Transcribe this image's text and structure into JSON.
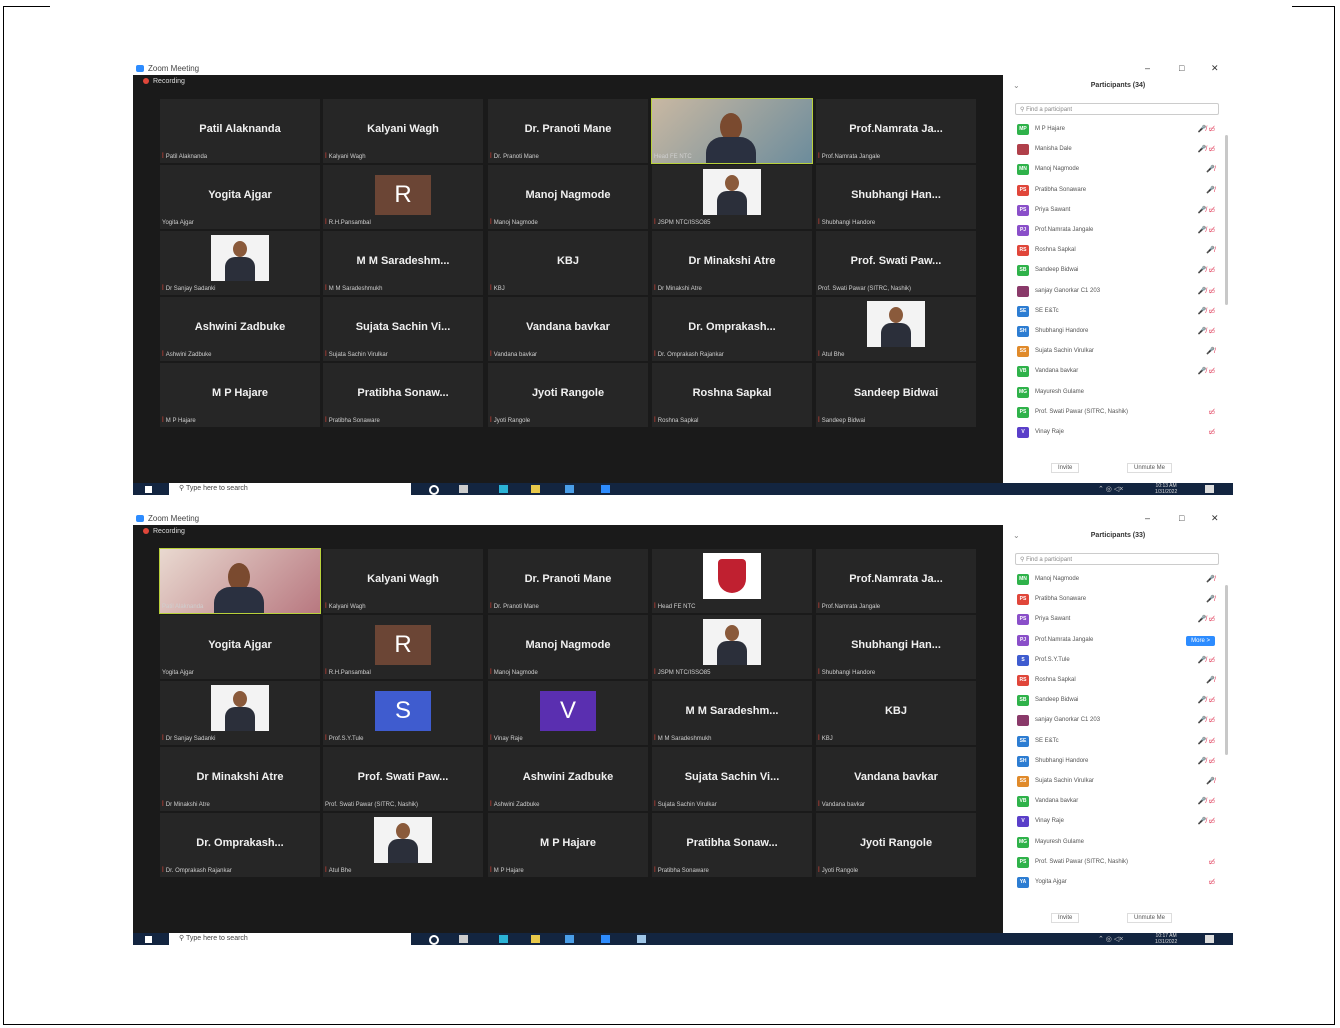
{
  "top": {
    "window_title": "Zoom Meeting",
    "recording": "Recording",
    "tiles": [
      {
        "name": "Patil Alaknanda",
        "label": "Patil Alaknanda",
        "type": "name"
      },
      {
        "name": "Kalyani Wagh",
        "label": "Kalyani Wagh",
        "type": "name"
      },
      {
        "name": "Dr. Pranoti Mane",
        "label": "Dr. Pranoti Mane",
        "type": "name"
      },
      {
        "name": "",
        "label": "Head FE NTC",
        "type": "video"
      },
      {
        "name": "Prof.Namrata Ja...",
        "label": "Prof.Namrata Jangale",
        "type": "name"
      },
      {
        "name": "Yogita Ajgar",
        "label": "Yogita Ajgar",
        "type": "name"
      },
      {
        "name": "R",
        "label": "R.H.Pansambal",
        "type": "avatar",
        "color": "#6b4535"
      },
      {
        "name": "Manoj Nagmode",
        "label": "Manoj Nagmode",
        "type": "name"
      },
      {
        "name": "",
        "label": "JSPM NTC/ISSO85",
        "type": "photo"
      },
      {
        "name": "Shubhangi Han...",
        "label": "Shubhangi Handore",
        "type": "name"
      },
      {
        "name": "",
        "label": "Dr Sanjay Sadanki",
        "type": "photo"
      },
      {
        "name": "M M Saradeshm...",
        "label": "M M Saradeshmukh",
        "type": "name"
      },
      {
        "name": "KBJ",
        "label": "KBJ",
        "type": "name"
      },
      {
        "name": "Dr Minakshi Atre",
        "label": "Dr Minakshi Atre",
        "type": "name"
      },
      {
        "name": "Prof. Swati Paw...",
        "label": "Prof. Swati Pawar (SITRC, Nashik)",
        "type": "name"
      },
      {
        "name": "Ashwini Zadbuke",
        "label": "Ashwini Zadbuke",
        "type": "name"
      },
      {
        "name": "Sujata Sachin Vi...",
        "label": "Sujata Sachin Virulkar",
        "type": "name"
      },
      {
        "name": "Vandana bavkar",
        "label": "Vandana bavkar",
        "type": "name"
      },
      {
        "name": "Dr. Omprakash...",
        "label": "Dr. Omprakash Rajankar",
        "type": "name"
      },
      {
        "name": "",
        "label": "Atul Bhe",
        "type": "photo"
      },
      {
        "name": "M P Hajare",
        "label": "M P Hajare",
        "type": "name"
      },
      {
        "name": "Pratibha Sonaw...",
        "label": "Pratibha Sonaware",
        "type": "name"
      },
      {
        "name": "Jyoti Rangole",
        "label": "Jyoti Rangole",
        "type": "name"
      },
      {
        "name": "Roshna Sapkal",
        "label": "Roshna Sapkal",
        "type": "name"
      },
      {
        "name": "Sandeep Bidwai",
        "label": "Sandeep Bidwai",
        "type": "name"
      }
    ],
    "panel_title": "Participants (34)",
    "search_placeholder": "Find a participant",
    "participants": [
      {
        "initials": "MP",
        "name": "M P Hajare",
        "color": "#2fb24a",
        "icons": "🎤̸ ▭̸"
      },
      {
        "initials": "",
        "name": "Manisha Dale",
        "color": "#b0404a",
        "icons": "🎤̸ ▭̸"
      },
      {
        "initials": "MN",
        "name": "Manoj Nagmode",
        "color": "#2fb24a",
        "icons": "🎤̸"
      },
      {
        "initials": "PS",
        "name": "Pratibha Sonaware",
        "color": "#e0463a",
        "icons": "🎤̸"
      },
      {
        "initials": "PS",
        "name": "Priya Sawant",
        "color": "#8a4fc9",
        "icons": "🎤̸ ▭̸"
      },
      {
        "initials": "PJ",
        "name": "Prof.Namrata Jangale",
        "color": "#8a4fc9",
        "icons": "🎤̸ ▭̸"
      },
      {
        "initials": "RS",
        "name": "Roshna Sapkal",
        "color": "#e0463a",
        "icons": "🎤̸"
      },
      {
        "initials": "SB",
        "name": "Sandeep Bidwai",
        "color": "#2fb24a",
        "icons": "🎤̸ ▭̸"
      },
      {
        "initials": "",
        "name": "sanjay Ganorkar C1 203",
        "color": "#8a3a6a",
        "icons": "🎤̸ ▭̸"
      },
      {
        "initials": "SE",
        "name": "SE E&Tc",
        "color": "#2d7dd2",
        "icons": "🎤̸ ▭̸"
      },
      {
        "initials": "SH",
        "name": "Shubhangi Handore",
        "color": "#2d7dd2",
        "icons": "🎤̸ ▭̸"
      },
      {
        "initials": "SS",
        "name": "Sujata Sachin Virulkar",
        "color": "#e08a2a",
        "icons": "🎤̸"
      },
      {
        "initials": "VB",
        "name": "Vandana bavkar",
        "color": "#2fb24a",
        "icons": "🎤̸ ▭̸"
      },
      {
        "initials": "MG",
        "name": "Mayuresh Gulame",
        "color": "#2fb24a",
        "icons": ""
      },
      {
        "initials": "PS",
        "name": "Prof. Swati Pawar (SITRC, Nashik)",
        "color": "#2fb24a",
        "icons": "▭̸"
      },
      {
        "initials": "V",
        "name": "Vinay Raje",
        "color": "#5a3fc9",
        "icons": "▭̸"
      }
    ],
    "invite": "Invite",
    "unmute": "Unmute Me",
    "taskbar_search": "Type here to search",
    "time": "10:13 AM",
    "date": "1/31/2022"
  },
  "bottom": {
    "window_title": "Zoom Meeting",
    "recording": "Recording",
    "tiles": [
      {
        "name": "",
        "label": "Patil Alaknanda",
        "type": "video2"
      },
      {
        "name": "Kalyani Wagh",
        "label": "Kalyani Wagh",
        "type": "name"
      },
      {
        "name": "Dr. Pranoti Mane",
        "label": "Dr. Pranoti Mane",
        "type": "name"
      },
      {
        "name": "",
        "label": "Head FE NTC",
        "type": "logo"
      },
      {
        "name": "Prof.Namrata Ja...",
        "label": "Prof.Namrata Jangale",
        "type": "name"
      },
      {
        "name": "Yogita Ajgar",
        "label": "Yogita Ajgar",
        "type": "name"
      },
      {
        "name": "R",
        "label": "R.H.Pansambal",
        "type": "avatar",
        "color": "#6b4535"
      },
      {
        "name": "Manoj Nagmode",
        "label": "Manoj Nagmode",
        "type": "name"
      },
      {
        "name": "",
        "label": "JSPM NTC/ISSO85",
        "type": "photo"
      },
      {
        "name": "Shubhangi Han...",
        "label": "Shubhangi Handore",
        "type": "name"
      },
      {
        "name": "",
        "label": "Dr Sanjay Sadanki",
        "type": "photo"
      },
      {
        "name": "S",
        "label": "Prof.S.Y.Tule",
        "type": "avatar",
        "color": "#3f5ccf"
      },
      {
        "name": "V",
        "label": "Vinay Raje",
        "type": "avatar",
        "color": "#5a2fb0"
      },
      {
        "name": "M M Saradeshm...",
        "label": "M M Saradeshmukh",
        "type": "name"
      },
      {
        "name": "KBJ",
        "label": "KBJ",
        "type": "name"
      },
      {
        "name": "Dr Minakshi Atre",
        "label": "Dr Minakshi Atre",
        "type": "name"
      },
      {
        "name": "Prof. Swati Paw...",
        "label": "Prof. Swati Pawar (SITRC, Nashik)",
        "type": "name"
      },
      {
        "name": "Ashwini Zadbuke",
        "label": "Ashwini Zadbuke",
        "type": "name"
      },
      {
        "name": "Sujata Sachin Vi...",
        "label": "Sujata Sachin Virulkar",
        "type": "name"
      },
      {
        "name": "Vandana bavkar",
        "label": "Vandana bavkar",
        "type": "name"
      },
      {
        "name": "Dr. Omprakash...",
        "label": "Dr. Omprakash Rajankar",
        "type": "name"
      },
      {
        "name": "",
        "label": "Atul Bhe",
        "type": "photo"
      },
      {
        "name": "M P Hajare",
        "label": "M P Hajare",
        "type": "name"
      },
      {
        "name": "Pratibha Sonaw...",
        "label": "Pratibha Sonaware",
        "type": "name"
      },
      {
        "name": "Jyoti Rangole",
        "label": "Jyoti Rangole",
        "type": "name"
      }
    ],
    "panel_title": "Participants (33)",
    "search_placeholder": "Find a participant",
    "participants": [
      {
        "initials": "MN",
        "name": "Manoj Nagmode",
        "color": "#2fb24a",
        "icons": "🎤̸"
      },
      {
        "initials": "PS",
        "name": "Pratibha Sonaware",
        "color": "#e0463a",
        "icons": "🎤̸"
      },
      {
        "initials": "PS",
        "name": "Priya Sawant",
        "color": "#8a4fc9",
        "icons": "🎤̸ ▭̸"
      },
      {
        "initials": "PJ",
        "name": "Prof.Namrata Jangale",
        "color": "#8a4fc9",
        "icons": "",
        "more": "More >"
      },
      {
        "initials": "S",
        "name": "Prof.S.Y.Tule",
        "color": "#3f5ccf",
        "icons": "🎤̸ ▭̸"
      },
      {
        "initials": "RS",
        "name": "Roshna Sapkal",
        "color": "#e0463a",
        "icons": "🎤̸"
      },
      {
        "initials": "SB",
        "name": "Sandeep Bidwai",
        "color": "#2fb24a",
        "icons": "🎤̸ ▭̸"
      },
      {
        "initials": "",
        "name": "sanjay Ganorkar C1 203",
        "color": "#8a3a6a",
        "icons": "🎤̸ ▭̸"
      },
      {
        "initials": "SE",
        "name": "SE E&Tc",
        "color": "#2d7dd2",
        "icons": "🎤̸ ▭̸"
      },
      {
        "initials": "SH",
        "name": "Shubhangi Handore",
        "color": "#2d7dd2",
        "icons": "🎤̸ ▭̸"
      },
      {
        "initials": "SS",
        "name": "Sujata Sachin Virulkar",
        "color": "#e08a2a",
        "icons": "🎤̸"
      },
      {
        "initials": "VB",
        "name": "Vandana bavkar",
        "color": "#2fb24a",
        "icons": "🎤̸ ▭̸"
      },
      {
        "initials": "V",
        "name": "Vinay Raje",
        "color": "#5a3fc9",
        "icons": "🎤̸ ▭̸"
      },
      {
        "initials": "MG",
        "name": "Mayuresh Gulame",
        "color": "#2fb24a",
        "icons": ""
      },
      {
        "initials": "PS",
        "name": "Prof. Swati Pawar (SITRC, Nashik)",
        "color": "#2fb24a",
        "icons": "▭̸"
      },
      {
        "initials": "YA",
        "name": "Yogita Ajgar",
        "color": "#2d7dd2",
        "icons": "▭̸"
      }
    ],
    "invite": "Invite",
    "unmute": "Unmute Me",
    "taskbar_search": "Type here to search",
    "time": "10:17 AM",
    "date": "1/31/2022"
  }
}
